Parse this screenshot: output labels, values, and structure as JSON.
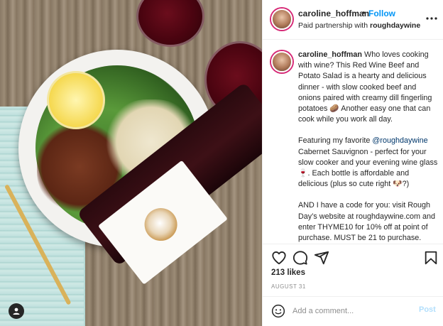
{
  "header": {
    "username": "caroline_hoffman",
    "separator": "•",
    "follow_label": "Follow",
    "partnership_prefix": "Paid partnership with ",
    "partner_name": "roughdaywine",
    "more_icon": "more-horizontal-icon"
  },
  "caption": {
    "username": "caroline_hoffman",
    "paragraph1": " Who loves cooking with wine? This Red Wine Beef and Potato Salad is a hearty and delicious dinner - with slow cooked beef and onions paired with creamy dill fingerling potatoes 🥔 Another easy one that can cook while you work all day.",
    "paragraph2_before": "Featuring my favorite ",
    "paragraph2_mention": "@roughdaywine",
    "paragraph2_after": " Cabernet Sauvignon - perfect for your slow cooker and your evening wine glass 🍷. Each bottle is affordable and delicious (plus so cute right 🐶?)",
    "paragraph3": "AND I have a code for you: visit Rough Day’s website at roughdaywine.com and enter THYME10 for 10% off at point of purchase. MUST be 21 to purchase."
  },
  "actions": {
    "likes": "213 likes",
    "date": "AUGUST 31"
  },
  "comment": {
    "placeholder": "Add a comment...",
    "post_label": "Post"
  },
  "colors": {
    "accent": "#0095f6",
    "post_disabled": "#b2dffc",
    "mention": "#00376b"
  }
}
